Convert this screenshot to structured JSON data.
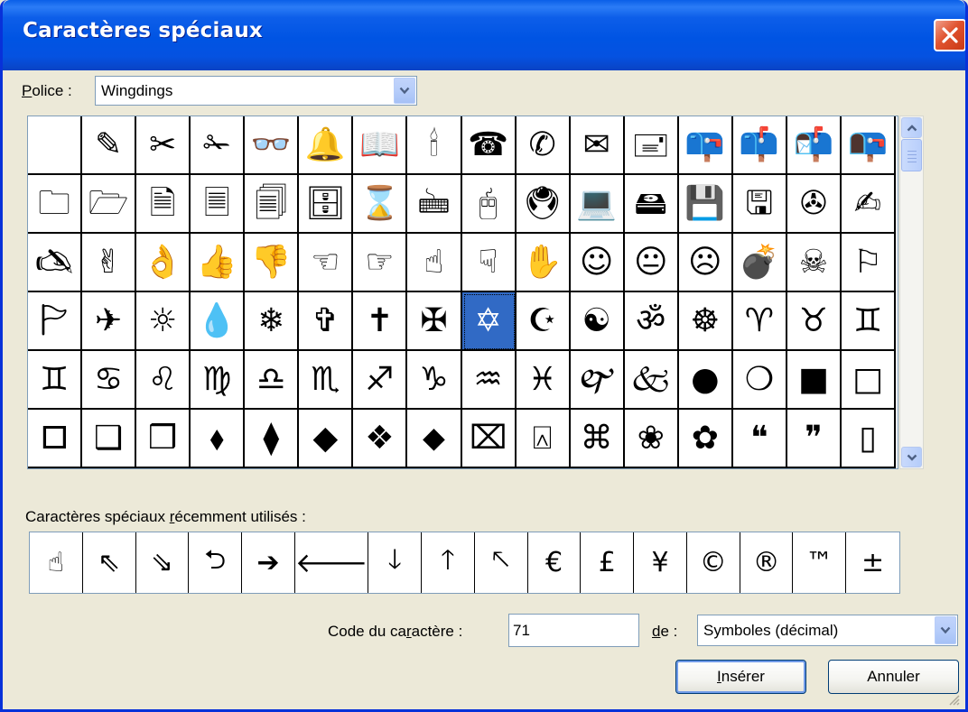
{
  "window": {
    "title": "Caractères spéciaux",
    "accent": "#0054e3",
    "close_color": "#e0532f"
  },
  "font": {
    "label_prefix": "P",
    "label_rest": "olice :",
    "value": "Wingdings"
  },
  "charmap": {
    "selected_index": 56,
    "cells": [
      "",
      "✎",
      "✂",
      "✁",
      "👓",
      "🔔",
      "📖",
      "🕯",
      "☎",
      "✆",
      "✉",
      "🖃",
      "📪",
      "📫",
      "📬",
      "📭",
      "🗀",
      "🗁",
      "🗎",
      "🗏",
      "🗐",
      "🗄",
      "⌛",
      "🖮",
      "🖰",
      "🖲",
      "💻",
      "🖴",
      "💾",
      "🖫",
      "✇",
      "✍",
      "🖎",
      "✌",
      "👌",
      "👍",
      "👎",
      "☜",
      "☞",
      "☝",
      "☟",
      "✋",
      "☺",
      "😐",
      "☹",
      "💣",
      "☠",
      "⚐",
      "🏱",
      "✈",
      "☼",
      "💧",
      "❄",
      "✞",
      "✝",
      "✠",
      "✡",
      "☪",
      "☯",
      "ॐ",
      "☸",
      "♈",
      "♉",
      "♊",
      "♊",
      "♋",
      "♌",
      "♍",
      "♎",
      "♏",
      "♐",
      "♑",
      "♒",
      "♓",
      "🙰",
      "🙵",
      "●",
      "❍",
      "■",
      "□",
      "🞐",
      "❑",
      "❒",
      "⬧",
      "⧫",
      "◆",
      "❖",
      "⬥",
      "⌧",
      "⍓",
      "⌘",
      "❀",
      "✿",
      "❝",
      "❞",
      "▯"
    ]
  },
  "recent": {
    "label_before": "Caractères spéciaux ",
    "label_underlined": "r",
    "label_after": "écemment utilisés :",
    "chars": [
      "☝",
      "⇖",
      "⇘",
      "⮌",
      "➔",
      "🡐",
      "🡓",
      "🡑",
      "🡔",
      "€",
      "£",
      "¥",
      "©",
      "®",
      "™",
      "±"
    ]
  },
  "code": {
    "label_before": "Code du ca",
    "label_underlined": "r",
    "label_after": "actère :",
    "value": "71"
  },
  "from": {
    "label_underlined": "d",
    "label_after": "e :",
    "value": "Symboles (décimal)"
  },
  "buttons": {
    "insert_underlined": "I",
    "insert_rest": "nsérer",
    "cancel": "Annuler"
  }
}
